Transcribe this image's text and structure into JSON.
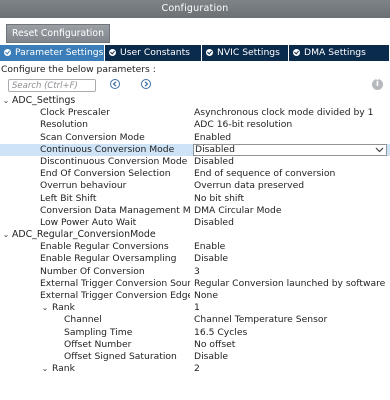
{
  "window": {
    "title": "Configuration"
  },
  "reset_button": {
    "label": "Reset Configuration"
  },
  "tabs": [
    {
      "label": "Parameter Settings",
      "active": true
    },
    {
      "label": "User Constants",
      "active": false
    },
    {
      "label": "NVIC Settings",
      "active": false
    },
    {
      "label": "DMA Settings",
      "active": false
    }
  ],
  "hint": "Configure the below parameters :",
  "search": {
    "placeholder": "Search (Ctrl+F)",
    "value": ""
  },
  "colors": {
    "tab_active": "#3a7db8",
    "tab_inactive": "#0b2b4d",
    "selected_row": "#cfe3f6"
  },
  "icons": {
    "info": "info-icon",
    "prev": "chevron-left-icon",
    "next": "chevron-right-icon"
  },
  "params": [
    {
      "kind": "group",
      "name": "ADC_Settings",
      "expanded": true
    },
    {
      "name": "Clock Prescaler",
      "value": "Asynchronous clock mode divided by 1"
    },
    {
      "name": "Resolution",
      "value": "ADC 16-bit resolution"
    },
    {
      "name": "Scan Conversion Mode",
      "value": "Enabled"
    },
    {
      "name": "Continuous Conversion Mode",
      "value": "Disabled",
      "selected": true,
      "dropdown": true
    },
    {
      "name": "Discontinuous Conversion Mode",
      "value": "Disabled"
    },
    {
      "name": "End Of Conversion Selection",
      "value": "End of sequence of conversion"
    },
    {
      "name": "Overrun behaviour",
      "value": "Overrun data preserved"
    },
    {
      "name": "Left Bit Shift",
      "value": "No bit shift"
    },
    {
      "name": "Conversion Data Management M...",
      "value": "DMA Circular Mode"
    },
    {
      "name": "Low Power Auto Wait",
      "value": "Disabled"
    },
    {
      "kind": "group",
      "name": "ADC_Regular_ConversionMode",
      "expanded": true
    },
    {
      "name": "Enable Regular Conversions",
      "value": "Enable"
    },
    {
      "name": "Enable Regular Oversampling",
      "value": "Disable"
    },
    {
      "name": "Number Of Conversion",
      "value": "3"
    },
    {
      "name": "External Trigger Conversion Source",
      "value": "Regular Conversion launched by software"
    },
    {
      "name": "External Trigger Conversion Edge",
      "value": "None"
    },
    {
      "kind": "subgroup",
      "name": "Rank",
      "value": "1",
      "expanded": true
    },
    {
      "kind": "leaf2",
      "name": "Channel",
      "value": "Channel Temperature Sensor"
    },
    {
      "kind": "leaf2",
      "name": "Sampling Time",
      "value": "16.5 Cycles"
    },
    {
      "kind": "leaf2",
      "name": "Offset Number",
      "value": "No offset"
    },
    {
      "kind": "leaf2",
      "name": "Offset Signed Saturation",
      "value": "Disable"
    },
    {
      "kind": "subgroup",
      "name": "Rank",
      "value": "2",
      "expanded": true
    }
  ]
}
